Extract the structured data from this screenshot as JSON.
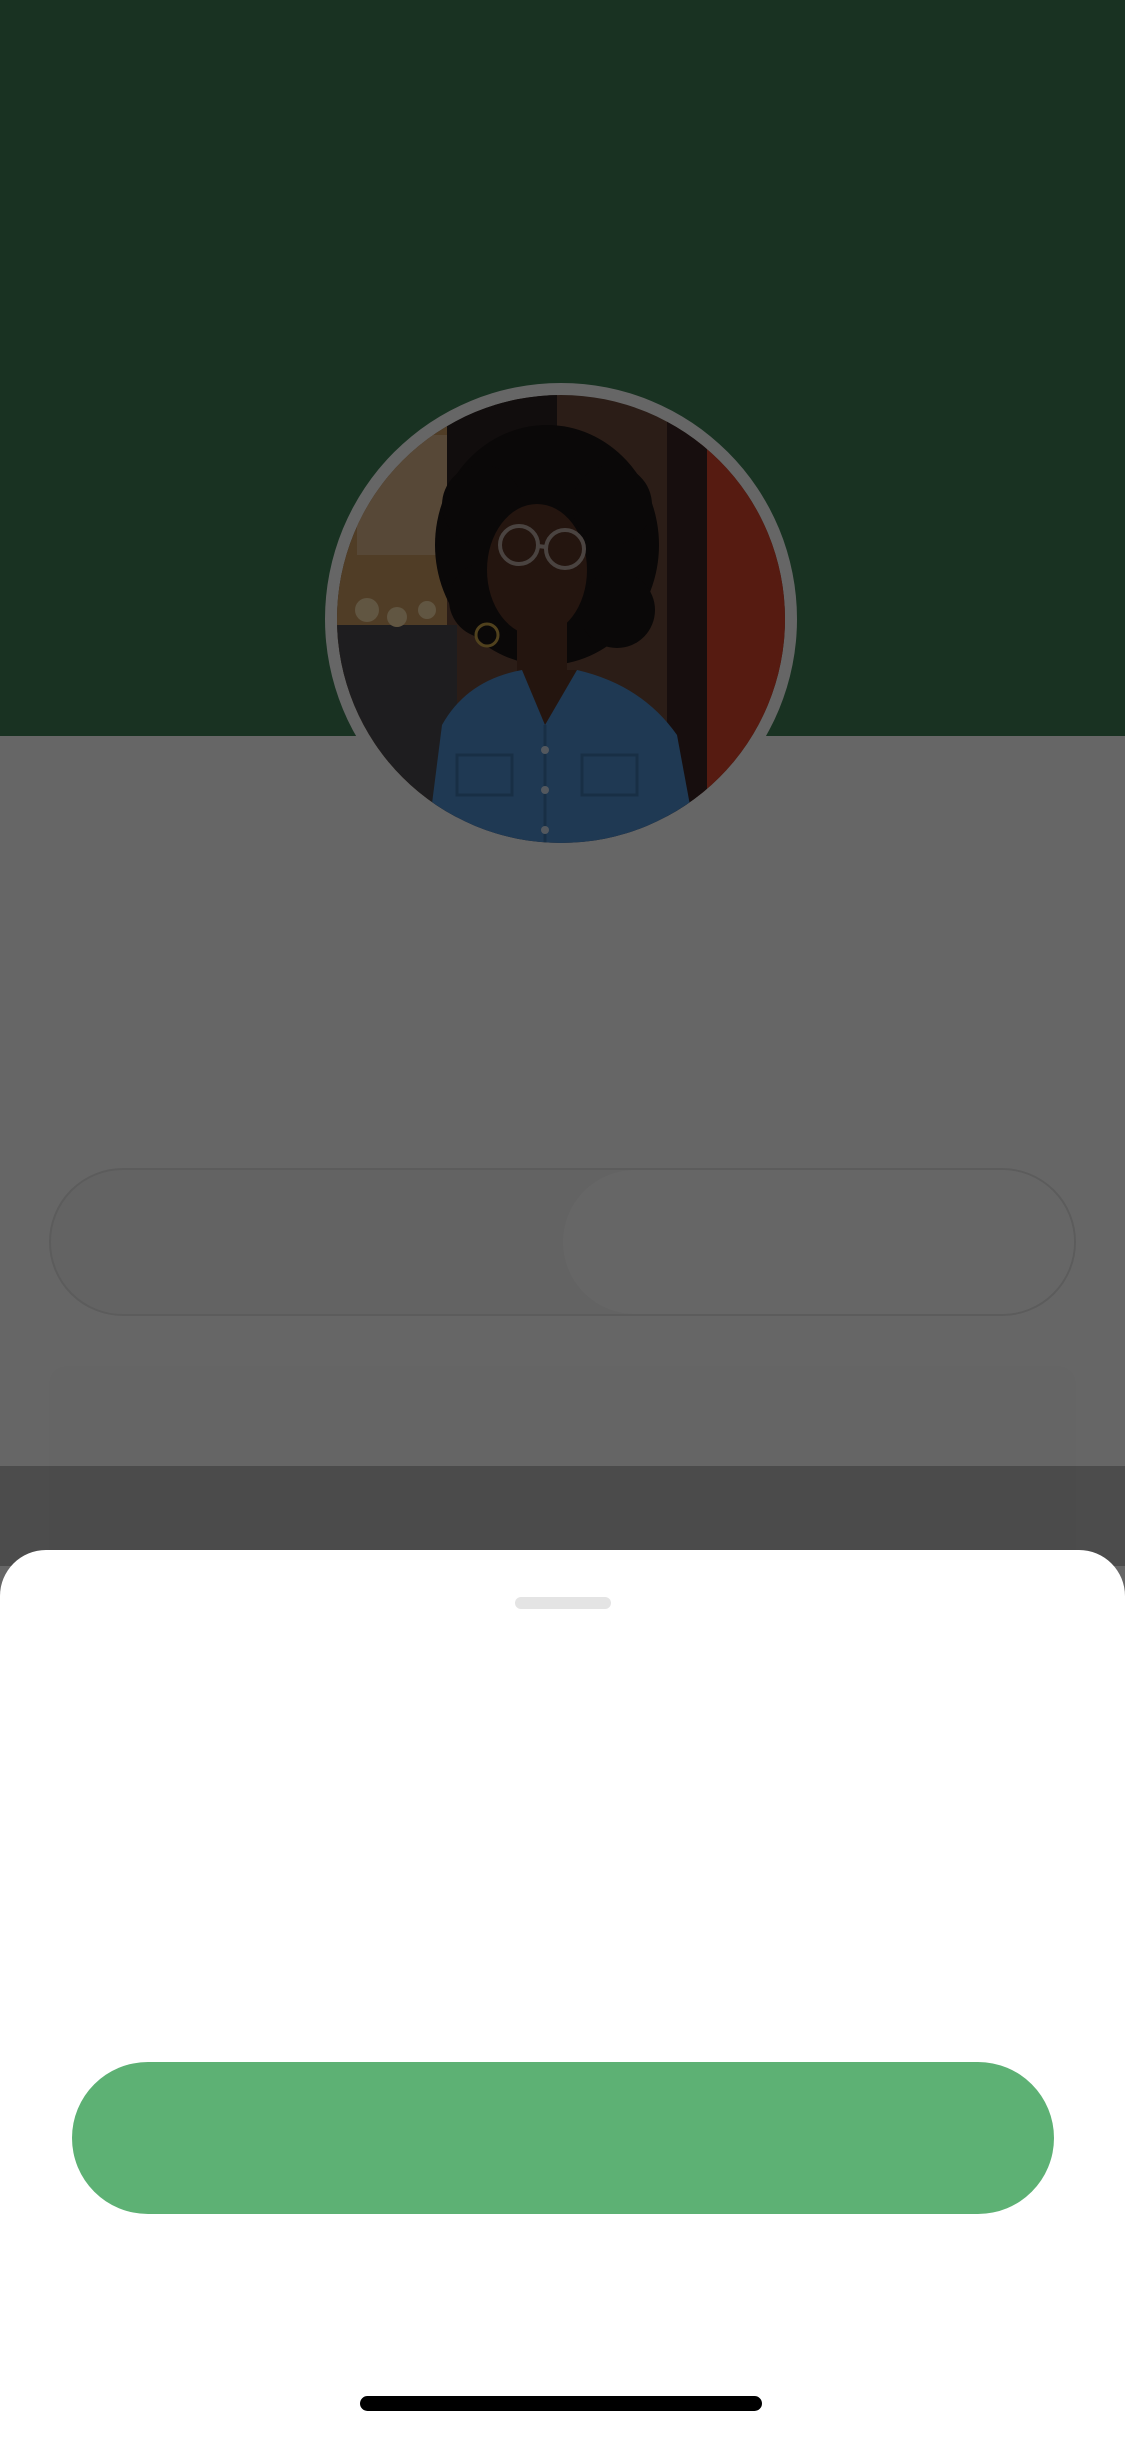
{
  "colors": {
    "header_green": "#3f7e55",
    "button_green": "#5db174",
    "page_background": "#ffffff",
    "sheet_background": "#ffffff",
    "scrim": "rgba(0,0,0,0.6)",
    "home_indicator": "#000000"
  },
  "profile": {
    "avatar": "profile-photo"
  },
  "tabs": [
    {
      "label": "",
      "selected": false
    },
    {
      "label": "",
      "selected": true
    }
  ],
  "sheet": {
    "title": "",
    "primary_button_label": ""
  }
}
